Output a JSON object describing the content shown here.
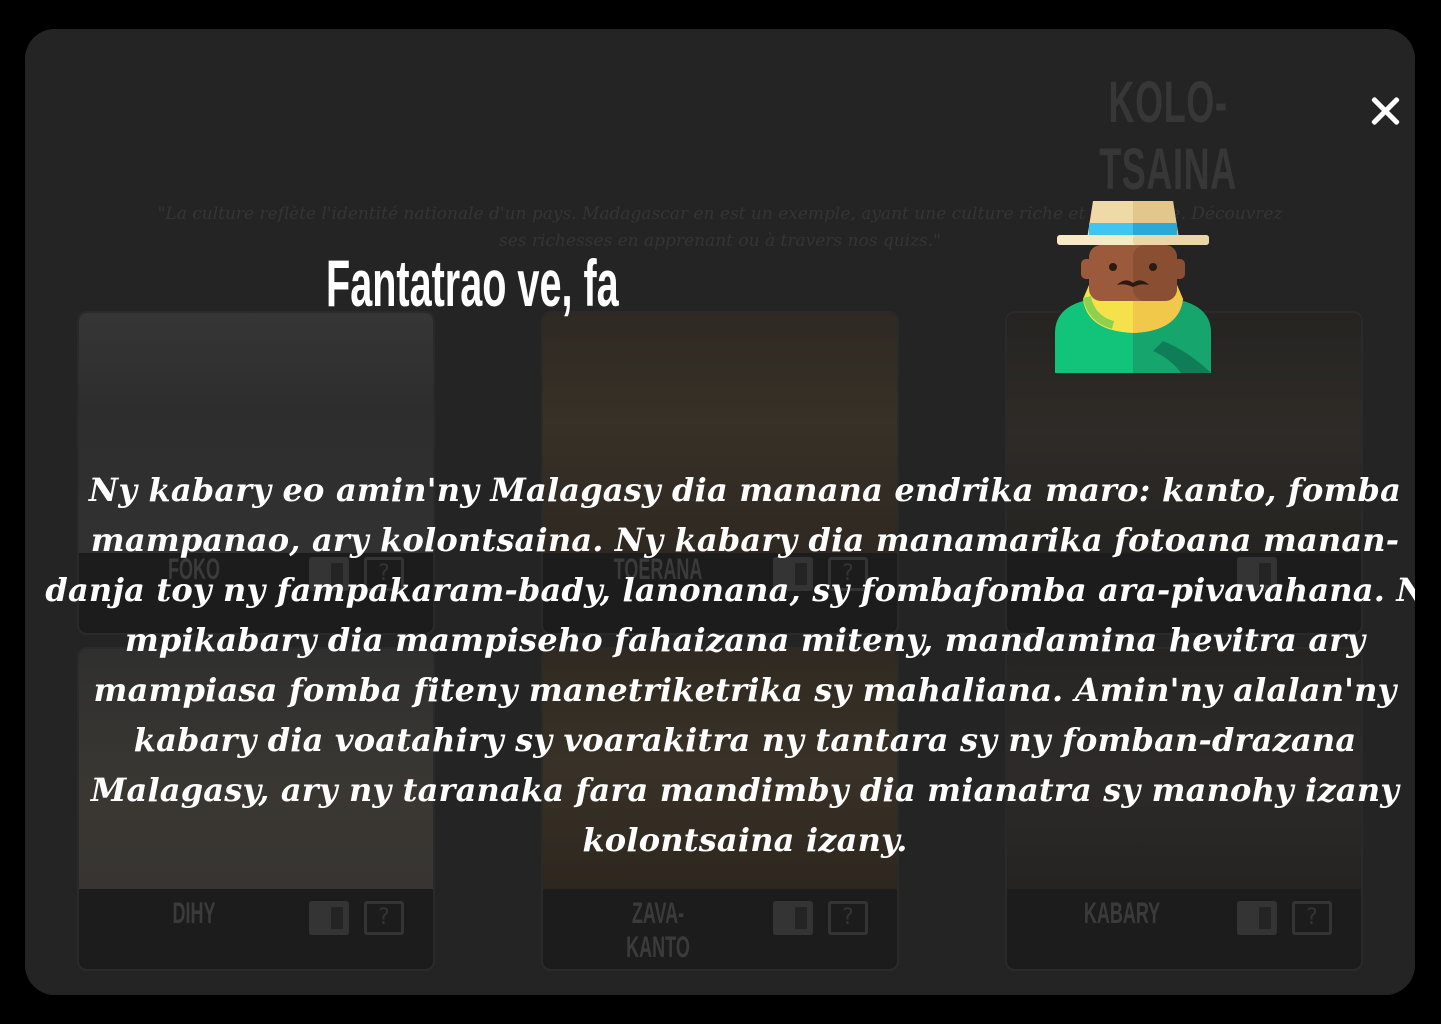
{
  "background": {
    "title": "KOLO-TSAINA",
    "quote": "\"La culture reflète l'identité nationale d'un pays. Madagascar en est un exemple, ayant une culture riche et diversifiée. Découvrez ses richesses en apprenant ou à travers nos quizs.\"",
    "cards": [
      {
        "name": "FOKO"
      },
      {
        "name": "TOERANA"
      },
      {
        "name": "DIHY"
      },
      {
        "name": "ZAVA-KANTO"
      },
      {
        "name": "KABARY"
      }
    ],
    "quiz_icon_glyph": "?"
  },
  "modal": {
    "title": "Fantatrao ve, fa",
    "text": "Ny kabary eo amin'ny Malagasy dia manana endrika maro: kanto, fomba mampanao, ary kolontsaina. Ny kabary dia manamarika fotoana manan-danja toy ny fampakaram-bady, lanonana, sy fombafomba ara-pivavahana. Ny mpikabary dia mampiseho fahaizana miteny, mandamina hevitra ary mampiasa fomba fiteny manetriketrika sy mahaliana. Amin'ny alalan'ny kabary dia voatahiry sy voarakitra ny tantara sy ny fomban-drazana Malagasy, ary ny taranaka fara mandimby dia mianatra sy manohy izany kolontsaina izany.",
    "close_icon": "close-icon",
    "avatar_icon": "malagasy-man-avatar-icon"
  },
  "colors": {
    "overlay_bg": "#3a3a3a",
    "text": "#ffffff"
  }
}
